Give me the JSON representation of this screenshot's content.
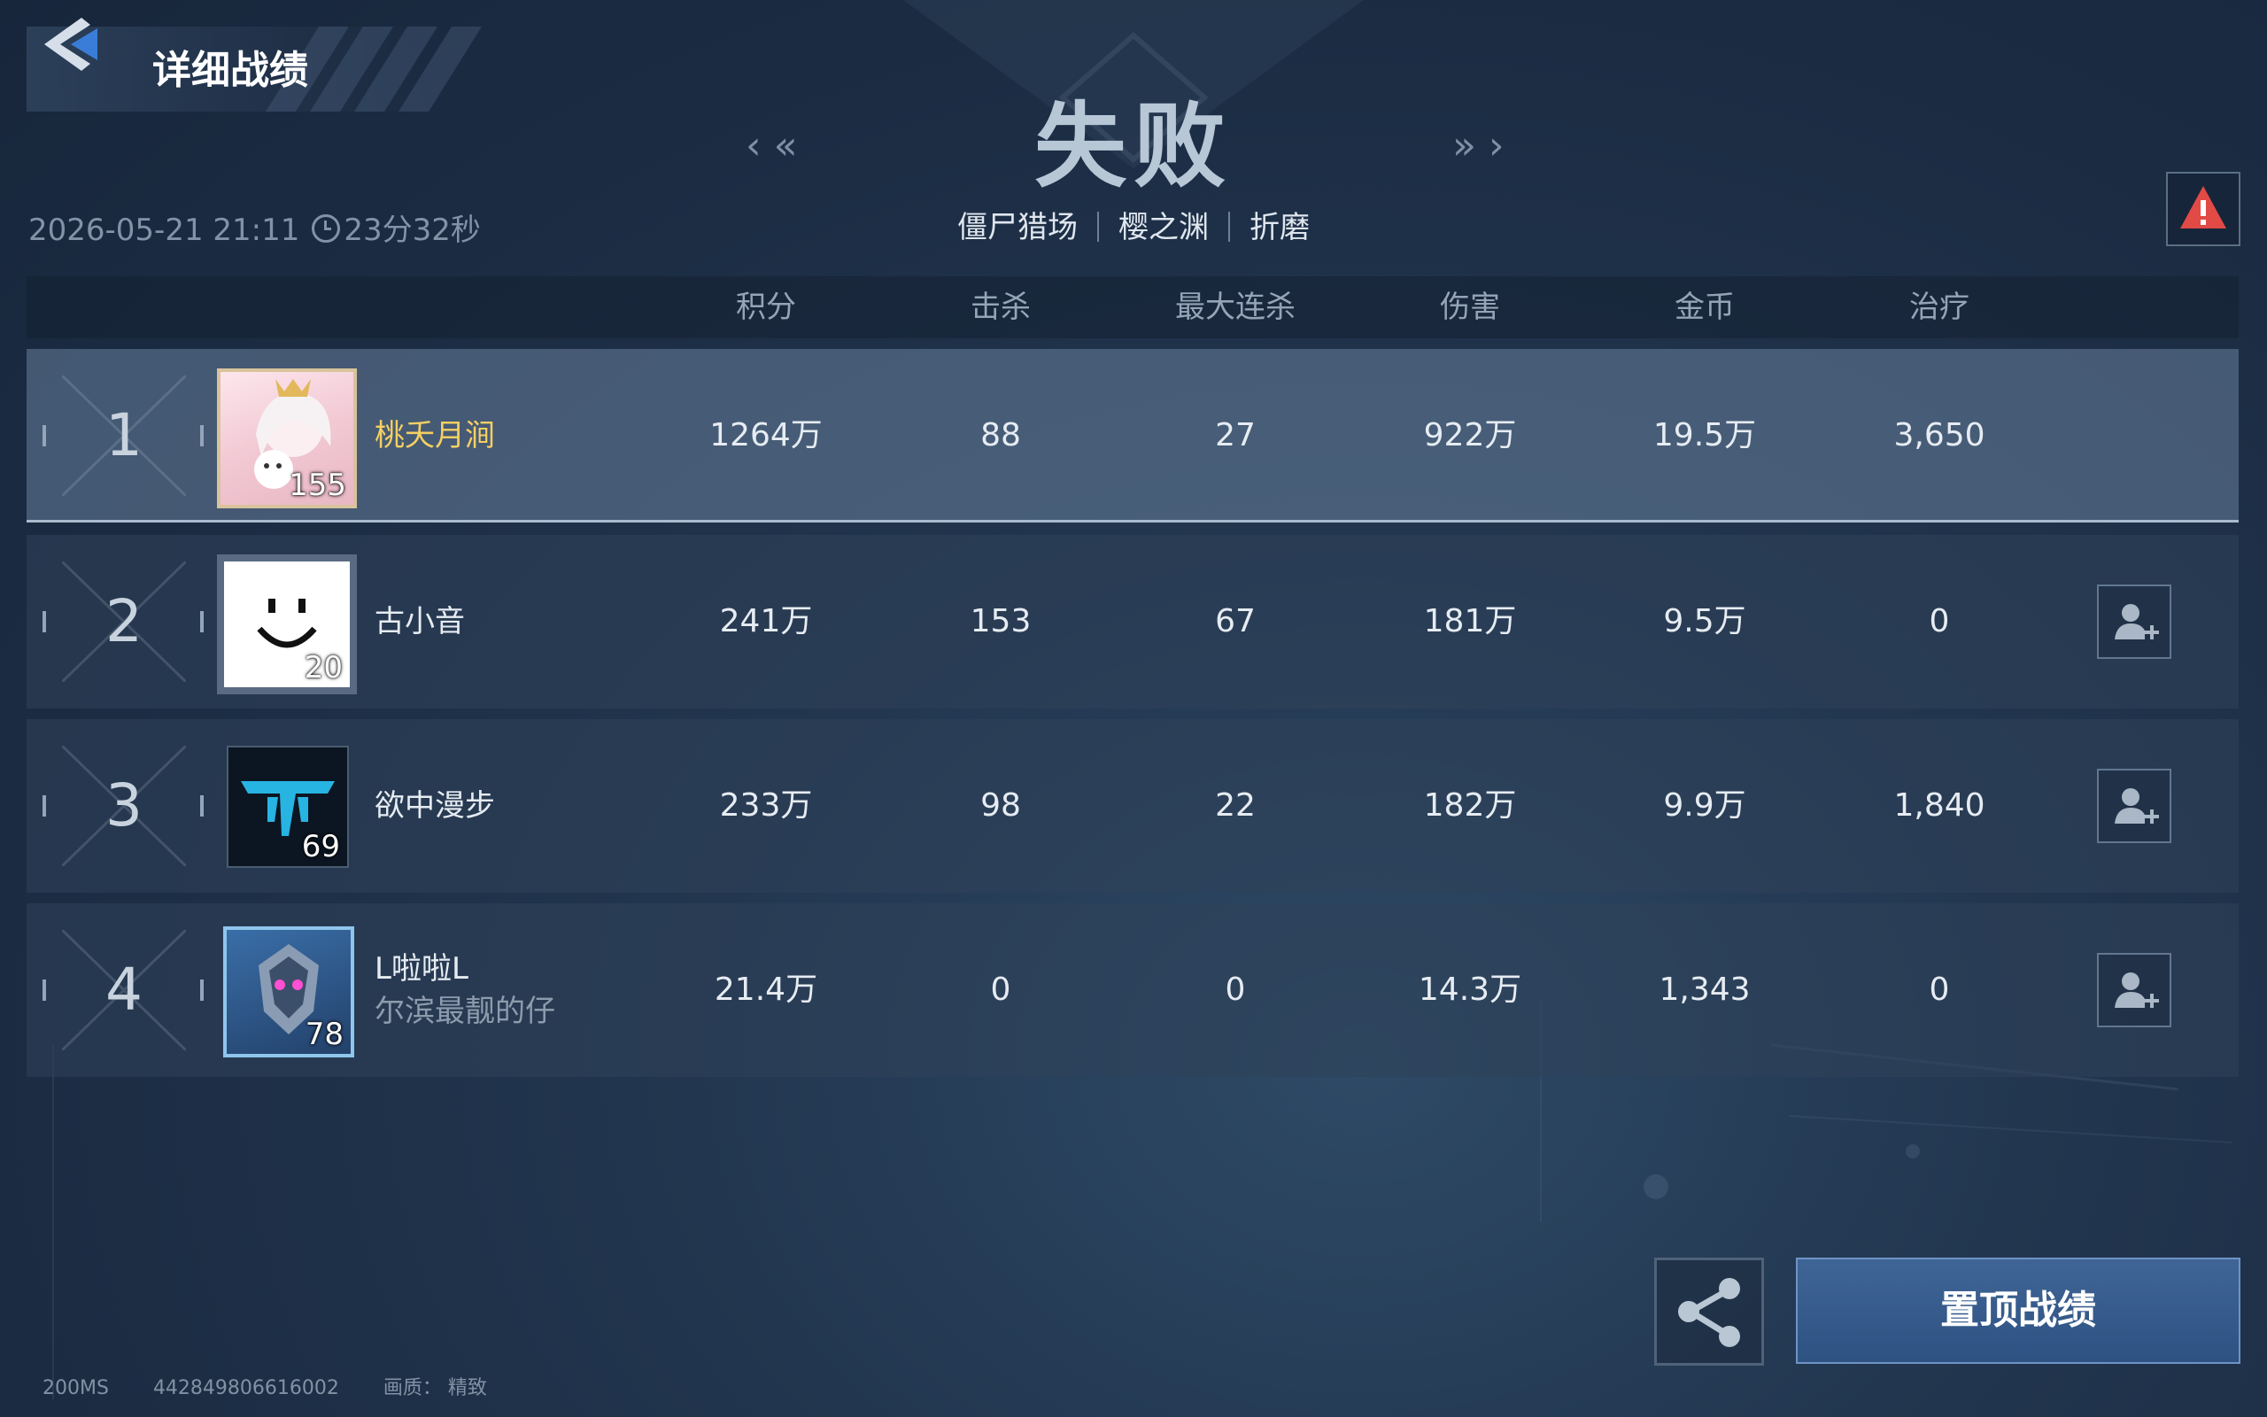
{
  "header": {
    "title": "详细战绩",
    "result": "失败",
    "prev_arrow": "‹ «",
    "next_arrow": "» ›",
    "mode": "僵尸猎场",
    "map": "樱之渊",
    "difficulty": "折磨",
    "datetime": "2026-05-21 21:11",
    "duration": "23分32秒"
  },
  "columns": [
    "积分",
    "击杀",
    "最大连杀",
    "伤害",
    "金币",
    "治疗"
  ],
  "rows": [
    {
      "rank": "1",
      "name": "桃夭月涧",
      "level": "155",
      "score": "1264万",
      "kills": "88",
      "max_streak": "27",
      "damage": "922万",
      "gold": "19.5万",
      "heal": "3,650"
    },
    {
      "rank": "2",
      "name": "古小音",
      "level": "20",
      "score": "241万",
      "kills": "153",
      "max_streak": "67",
      "damage": "181万",
      "gold": "9.5万",
      "heal": "0"
    },
    {
      "rank": "3",
      "name": "欲中漫步",
      "level": "69",
      "score": "233万",
      "kills": "98",
      "max_streak": "22",
      "damage": "182万",
      "gold": "9.9万",
      "heal": "1,840"
    },
    {
      "rank": "4",
      "name": "L啦啦L",
      "subtitle": "尔滨最靓的仔",
      "level": "78",
      "score": "21.4万",
      "kills": "0",
      "max_streak": "0",
      "damage": "14.3万",
      "gold": "1,343",
      "heal": "0"
    }
  ],
  "buttons": {
    "pin": "置顶战绩"
  },
  "footer": {
    "ping": "200MS",
    "id": "442849806616002",
    "quality": "画质：  精致"
  },
  "icons": {
    "back": "back-arrow-icon",
    "report": "warning-icon",
    "add_friend": "add-friend-icon",
    "share": "share-icon"
  },
  "colors": {
    "highlight_name": "#f4cf62",
    "report_red": "#e14a45",
    "pin_button": "#3f6596"
  }
}
